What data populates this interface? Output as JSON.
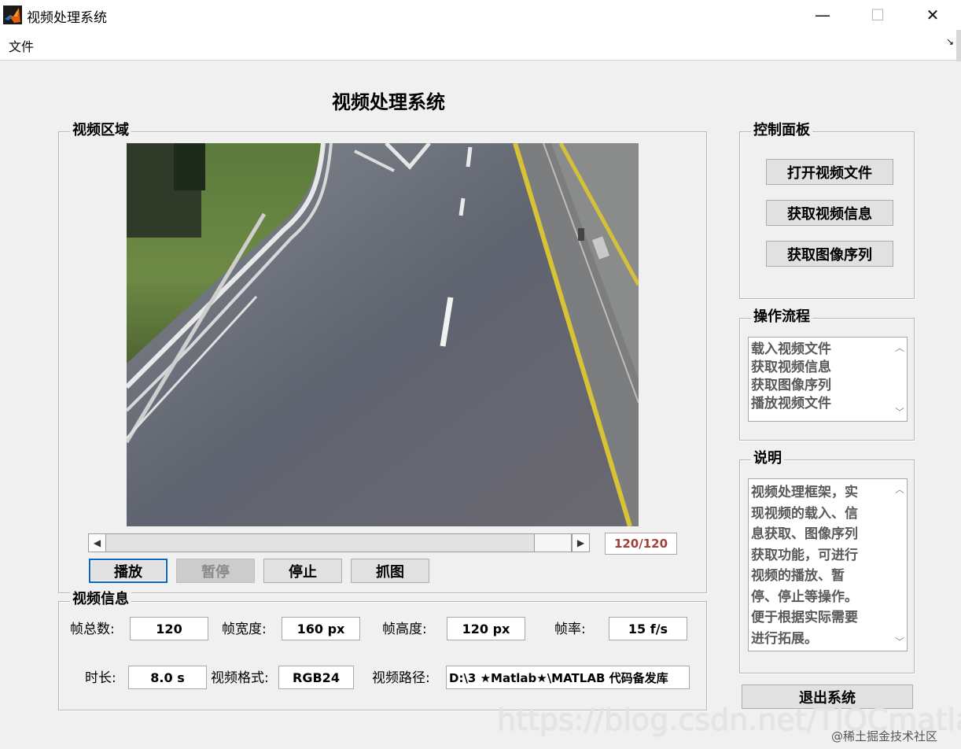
{
  "window": {
    "title": "视频处理系统",
    "minimize_glyph": "—",
    "maximize_glyph": "☐",
    "close_glyph": "✕"
  },
  "menu": {
    "items": [
      "文件"
    ]
  },
  "main_title": "视频处理系统",
  "video_panel": {
    "legend": "视频区域",
    "frame_counter": "120/120",
    "slider_position": 1.0,
    "buttons": {
      "play": "播放",
      "pause": "暂停",
      "stop": "停止",
      "capture": "抓图"
    }
  },
  "info_panel": {
    "legend": "视频信息",
    "total_frames_label": "帧总数:",
    "total_frames_value": "120",
    "frame_width_label": "帧宽度:",
    "frame_width_value": "160 px",
    "frame_height_label": "帧高度:",
    "frame_height_value": "120 px",
    "frame_rate_label": "帧率:",
    "frame_rate_value": "15 f/s",
    "duration_label": "时长:",
    "duration_value": "8.0 s",
    "format_label": "视频格式:",
    "format_value": "RGB24",
    "path_label": "视频路径:",
    "path_value": "D:\\3 ★Matlab★\\MATLAB 代码备发库"
  },
  "control_panel": {
    "legend": "控制面板",
    "buttons": {
      "open_video": "打开视频文件",
      "get_info": "获取视频信息",
      "get_sequence": "获取图像序列"
    }
  },
  "workflow_panel": {
    "legend": "操作流程",
    "items": [
      "载入视频文件",
      "获取视频信息",
      "获取图像序列",
      "播放视频文件"
    ]
  },
  "description_panel": {
    "legend": "说明",
    "lines": [
      "视频处理框架，实",
      "现视频的载入、信",
      "息获取、图像序列",
      "获取功能，可进行",
      "视频的播放、暂",
      "停、停止等操作。",
      "便于根据实际需要",
      "进行拓展。"
    ]
  },
  "exit_button": "退出系统",
  "watermark": "https://blog.csdn.net/TIQCmatlab",
  "credit": "@稀土掘金技术社区"
}
